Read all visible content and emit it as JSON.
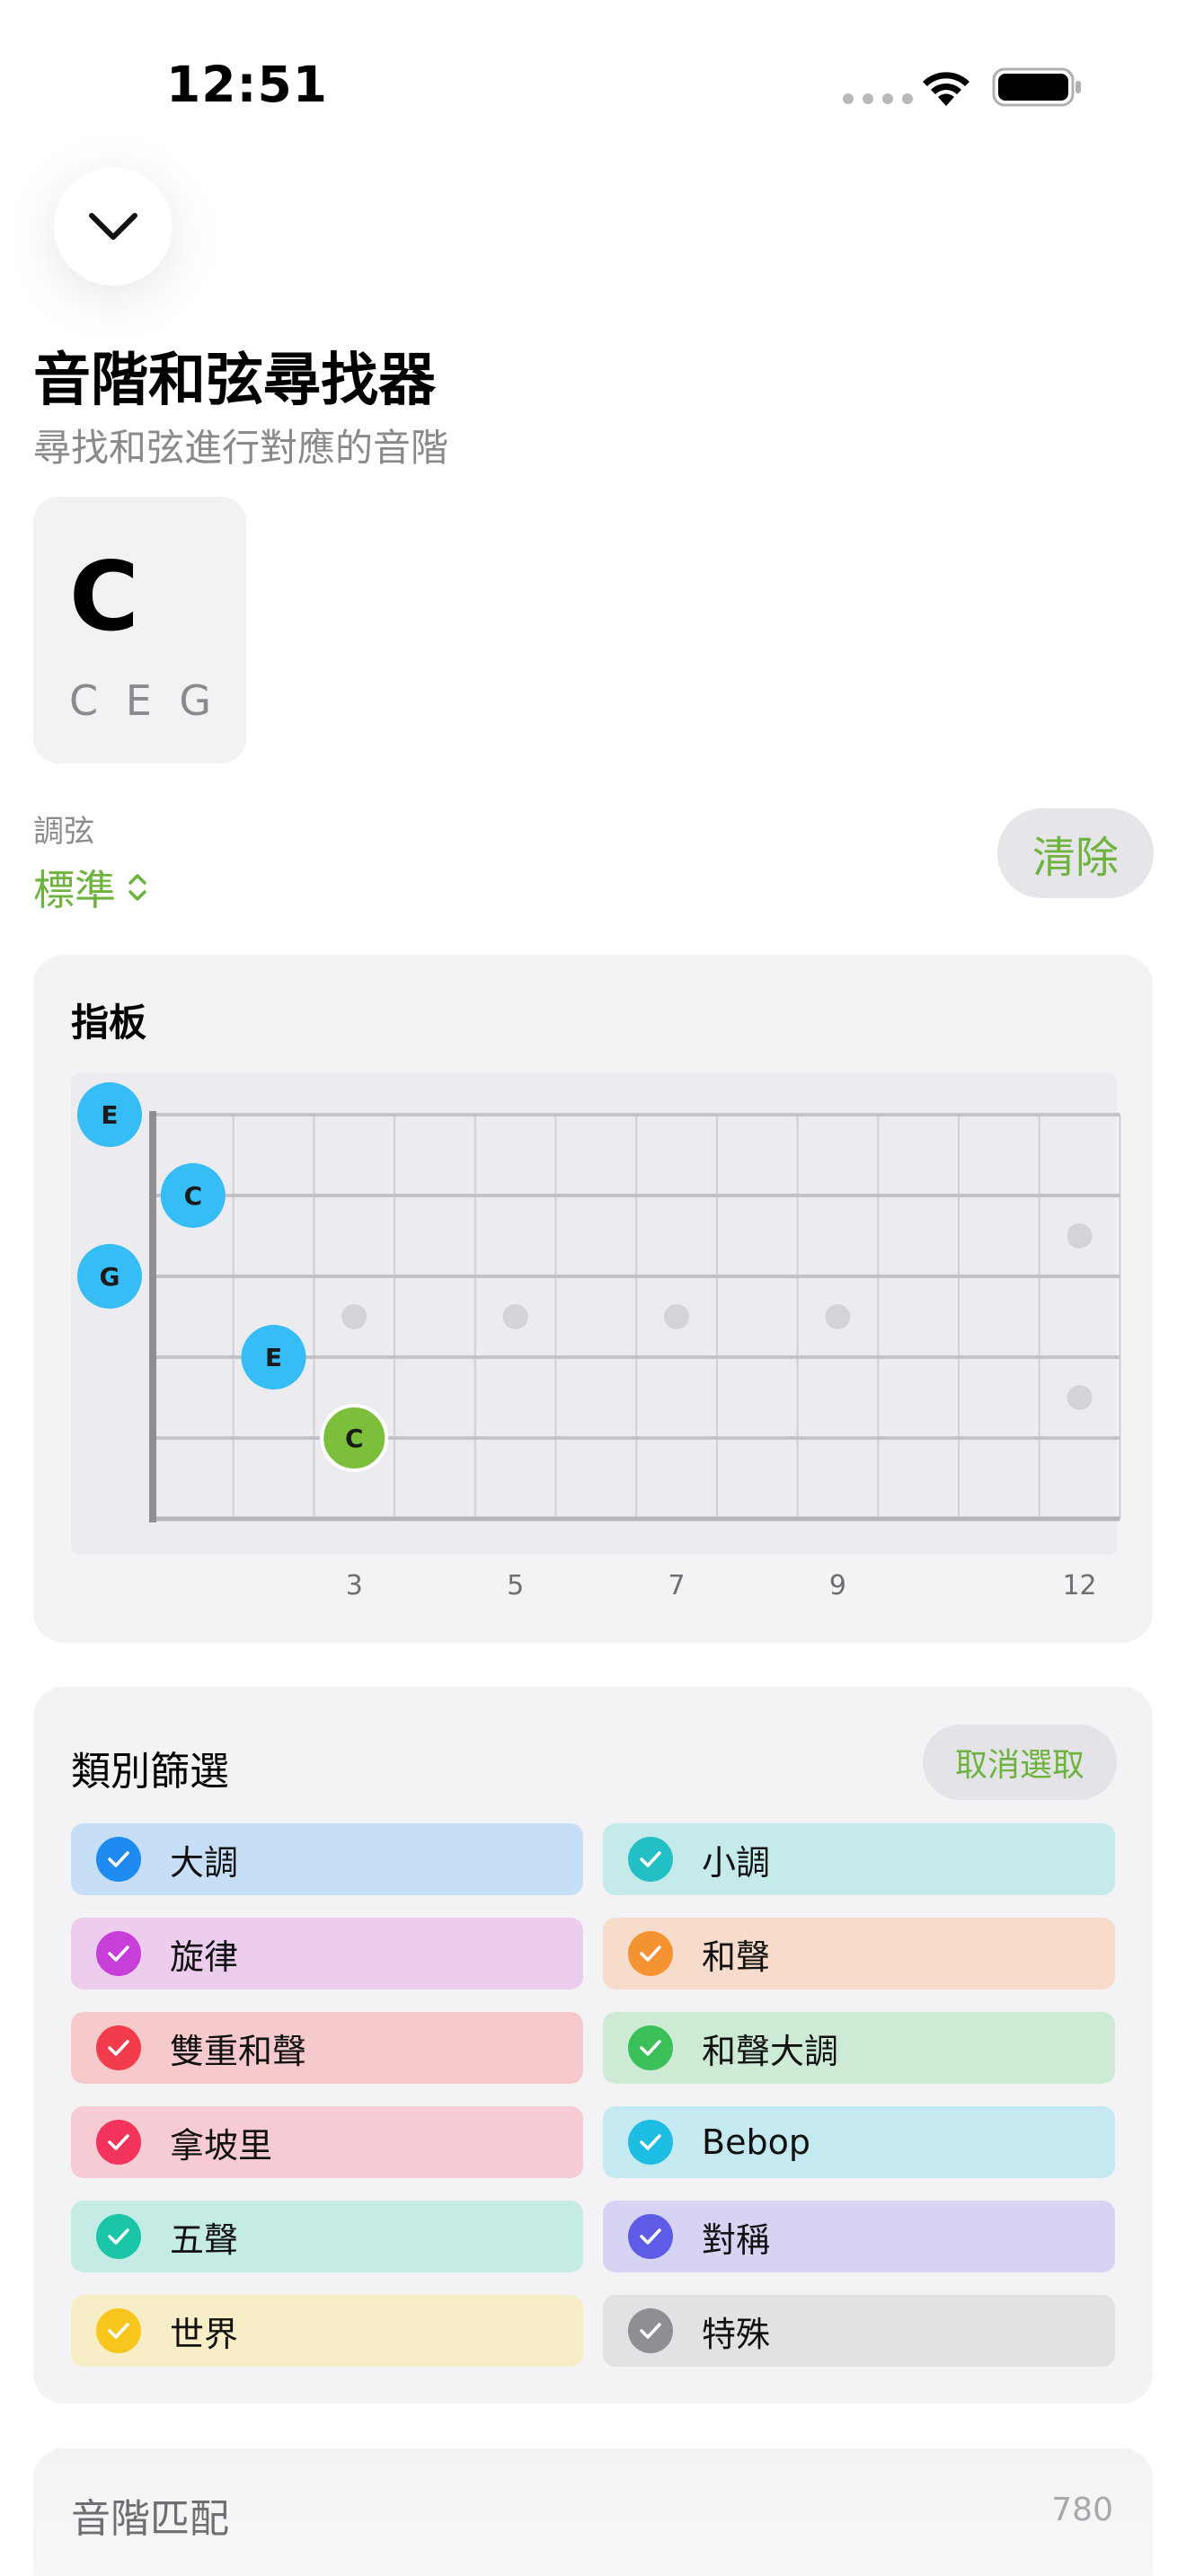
{
  "status_bar": {
    "time": "12:51"
  },
  "header": {
    "title": "音階和弦尋找器",
    "subtitle": "尋找和弦進行對應的音階"
  },
  "chord": {
    "name": "C",
    "notes": "C E G"
  },
  "tuning": {
    "label": "調弦",
    "value": "標準"
  },
  "clear_label": "清除",
  "fretboard": {
    "title": "指板",
    "fret_numbers": [
      "3",
      "5",
      "7",
      "9",
      "12"
    ],
    "markers": [
      {
        "label": "E",
        "string": 1,
        "fret": 0,
        "color": "#36bdf5"
      },
      {
        "label": "C",
        "string": 2,
        "fret": 1,
        "color": "#36bdf5"
      },
      {
        "label": "G",
        "string": 3,
        "fret": 0,
        "color": "#36bdf5"
      },
      {
        "label": "E",
        "string": 4,
        "fret": 2,
        "color": "#36bdf5"
      },
      {
        "label": "C",
        "string": 5,
        "fret": 3,
        "color": "#7bbf3a",
        "root": true
      }
    ]
  },
  "categories": {
    "title": "類別篩選",
    "deselect_label": "取消選取",
    "items": [
      {
        "label": "大調",
        "bg": "#c6def6",
        "check": "#1f8af0"
      },
      {
        "label": "小調",
        "bg": "#c4ebe9",
        "check": "#22c0c6"
      },
      {
        "label": "旋律",
        "bg": "#eccdee",
        "check": "#c83ed8"
      },
      {
        "label": "和聲",
        "bg": "#f7dccb",
        "check": "#f59332"
      },
      {
        "label": "雙重和聲",
        "bg": "#f6cacd",
        "check": "#f23b4b"
      },
      {
        "label": "和聲大調",
        "bg": "#cdebd4",
        "check": "#3bbf59"
      },
      {
        "label": "拿坡里",
        "bg": "#f6cbd3",
        "check": "#f2335c"
      },
      {
        "label": "Bebop",
        "bg": "#c4e9f1",
        "check": "#1ebde3"
      },
      {
        "label": "五聲",
        "bg": "#c4ece5",
        "check": "#1bc6a8"
      },
      {
        "label": "對稱",
        "bg": "#d6d4f2",
        "check": "#5e5ce6"
      },
      {
        "label": "世界",
        "bg": "#f7edc7",
        "check": "#f7c51c"
      },
      {
        "label": "特殊",
        "bg": "#e2e2e4",
        "check": "#8e8e93"
      }
    ]
  },
  "scale_match": {
    "title": "音階匹配",
    "count": "780"
  },
  "colors": {
    "accent": "#6fb33f"
  },
  "icons": {
    "collapse": "chevron-down-icon",
    "tuning": "chevron-up-down-icon",
    "wifi": "wifi-icon",
    "battery": "battery-icon",
    "check": "checkmark-icon"
  }
}
